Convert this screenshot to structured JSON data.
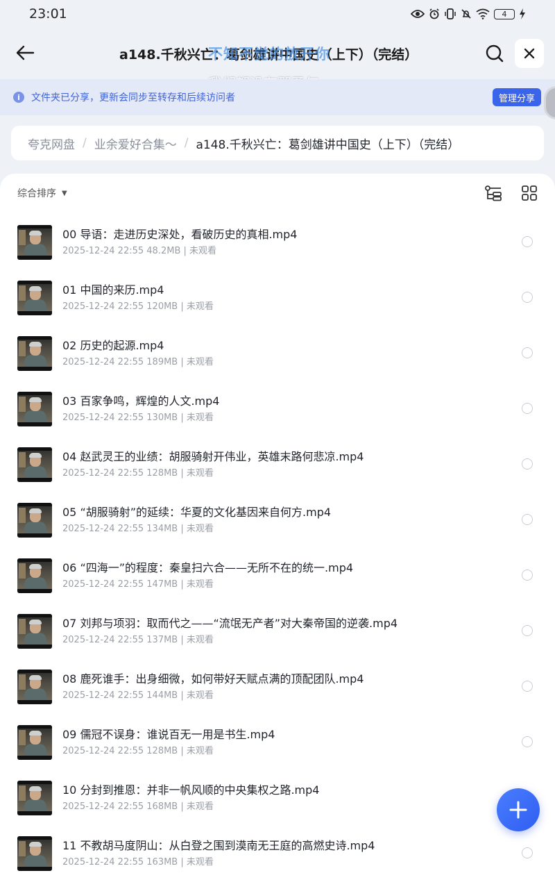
{
  "status_bar": {
    "time": "23:01",
    "icons": [
      "eye-icon",
      "alarm-icon",
      "vibrate-icon",
      "mute-icon",
      "wifi-icon",
      "battery-icon",
      "charging-icon"
    ],
    "battery": "4"
  },
  "header": {
    "title": "a148.千秋兴亡：葛剑雄讲中国史（上下）（完结）"
  },
  "lyrics": {
    "line1": "不知不觉的放开你",
    "line2": "我们都没有那勇气"
  },
  "share_banner": {
    "text": "文件夹已分享，更新会同步至转存和后续访问者",
    "button": "管理分享",
    "accent": "#3a64ea"
  },
  "breadcrumb": {
    "items": [
      "夸克网盘",
      "业余爱好合集～",
      "a148.千秋兴亡：葛剑雄讲中国史（上下）（完结）"
    ],
    "separator": "/"
  },
  "toolbar": {
    "sort_label": "综合排序"
  },
  "files": [
    {
      "name": "00 导语：走进历史深处，看破历史的真相.mp4",
      "meta": "2025-12-24 22:55  48.2MB | 未观看"
    },
    {
      "name": "01 中国的来历.mp4",
      "meta": "2025-12-24 22:55  120MB | 未观看"
    },
    {
      "name": "02 历史的起源.mp4",
      "meta": "2025-12-24 22:55  189MB | 未观看"
    },
    {
      "name": "03 百家争鸣，辉煌的人文.mp4",
      "meta": "2025-12-24 22:55  130MB | 未观看"
    },
    {
      "name": "04 赵武灵王的业绩：胡服骑射开伟业，英雄末路何悲凉.mp4",
      "meta": "2025-12-24 22:55  128MB | 未观看"
    },
    {
      "name": "05 “胡服骑射”的延续：华夏的文化基因来自何方.mp4",
      "meta": "2025-12-24 22:55  134MB | 未观看"
    },
    {
      "name": "06 “四海一”的程度：秦皇扫六合——无所不在的统一.mp4",
      "meta": "2025-12-24 22:55  147MB | 未观看"
    },
    {
      "name": "07 刘邦与项羽：取而代之——“流氓无产者”对大秦帝国的逆袭.mp4",
      "meta": "2025-12-24 22:55  137MB | 未观看"
    },
    {
      "name": "08 鹿死谁手：出身细微，如何带好天赋点满的顶配团队.mp4",
      "meta": "2025-12-24 22:55  144MB | 未观看"
    },
    {
      "name": "09 儒冠不误身：谁说百无一用是书生.mp4",
      "meta": "2025-12-24 22:55  128MB | 未观看"
    },
    {
      "name": "10 分封到推恩：并非一帆风顺的中央集权之路.mp4",
      "meta": "2025-12-24 22:55  168MB | 未观看"
    },
    {
      "name": "11 不教胡马度阴山：从白登之围到漠南无王庭的高燃史诗.mp4",
      "meta": "2025-12-24 22:55  163MB | 未观看"
    }
  ]
}
